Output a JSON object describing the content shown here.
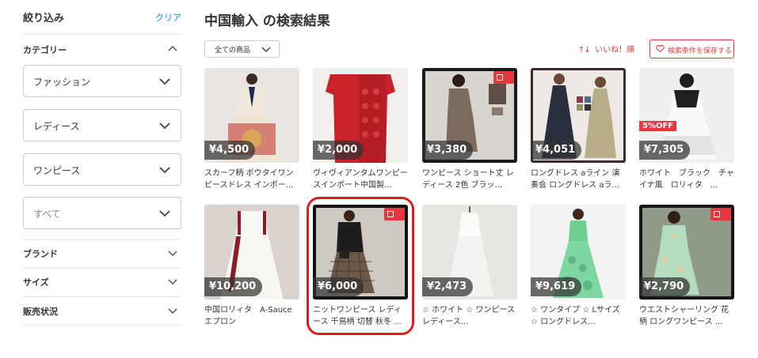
{
  "sidebar": {
    "title": "絞り込み",
    "clear": "クリア",
    "category_label": "カテゴリー",
    "selects": [
      {
        "value": "ファッション"
      },
      {
        "value": "レディース"
      },
      {
        "value": "ワンピース"
      },
      {
        "value": "すべて"
      }
    ],
    "brand_label": "ブランド",
    "size_label": "サイズ",
    "status_label": "販売状況"
  },
  "main": {
    "title": "中国輸入 の検索結果",
    "sort_value": "全ての商品",
    "likes_sort": "いいね！順",
    "likes_arrows": "↑↓",
    "save_button": "検索条件を保存する"
  },
  "products": [
    {
      "price": "¥4,500",
      "name": "スカーフ柄 ボウタイワンピースドレス インポー..."
    },
    {
      "price": "¥2,000",
      "name": "ヴィヴィアンタムワンピースインポート中国製..."
    },
    {
      "price": "¥3,380",
      "name": "ワンピース ショート丈 レディース 2色 ブラッ..."
    },
    {
      "price": "¥4,051",
      "name": "ロングドレス aライン 演奏会 ロングドレス aラ..."
    },
    {
      "price": "¥7,305",
      "name": "ホワイト　ブラック　チャイナ風　ロリィタ　...",
      "off": "5%OFF"
    },
    {
      "price": "¥10,200",
      "name": "中国ロリィタ　A-Sauce エプロン"
    },
    {
      "price": "¥6,000",
      "name": "ニットワンピース レディース 千鳥柄 切替 秋冬 ..."
    },
    {
      "price": "¥2,473",
      "name": "☆ ホワイト ☆ ワンピース レディース..."
    },
    {
      "price": "¥9,619",
      "name": "☆ ワンタイプ ☆ Lサイズ ☆ ロングドレス..."
    },
    {
      "price": "¥2,790",
      "name": "ウエストシャーリング 花柄 ロングワンピース ..."
    }
  ],
  "colors": {
    "accent_red": "#e03a3a",
    "link_blue": "#0095ee",
    "highlight": "#e01b1b"
  }
}
